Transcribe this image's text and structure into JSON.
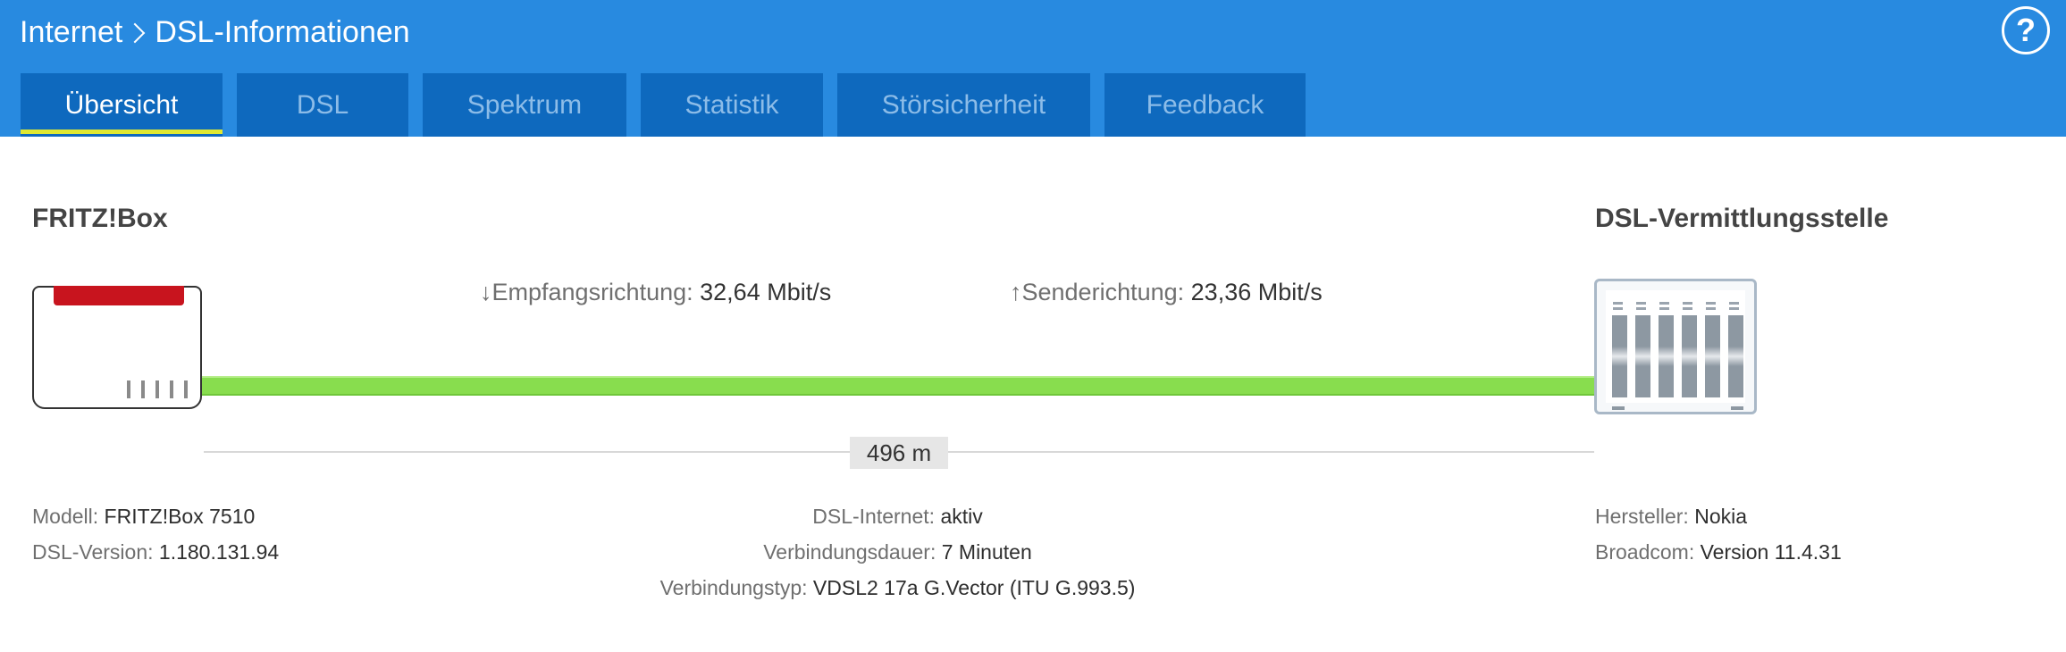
{
  "header": {
    "breadcrumb_parent": "Internet",
    "breadcrumb_current": "DSL-Informationen",
    "help_label": "?"
  },
  "tabs": [
    {
      "label": "Übersicht",
      "active": true
    },
    {
      "label": "DSL",
      "active": false
    },
    {
      "label": "Spektrum",
      "active": false
    },
    {
      "label": "Statistik",
      "active": false
    },
    {
      "label": "Störsicherheit",
      "active": false
    },
    {
      "label": "Feedback",
      "active": false
    }
  ],
  "diagram": {
    "left_title": "FRITZ!Box",
    "right_title": "DSL-Vermittlungsstelle",
    "downstream": {
      "arrow": "↓",
      "label": "Empfangsrichtung:",
      "value": "32,64 Mbit/s"
    },
    "upstream": {
      "arrow": "↑",
      "label": "Senderichtung:",
      "value": "23,36 Mbit/s"
    },
    "distance": "496 m",
    "line_status": "aktiv"
  },
  "info": {
    "left": [
      {
        "label": "Modell:",
        "value": "FRITZ!Box 7510"
      },
      {
        "label": "DSL-Version:",
        "value": "1.180.131.94"
      }
    ],
    "center": [
      {
        "label": "DSL-Internet:",
        "value": "aktiv"
      },
      {
        "label": "Verbindungsdauer:",
        "value": "7 Minuten"
      },
      {
        "label": "Verbindungstyp:",
        "value": "VDSL2 17a G.Vector (ITU G.993.5)"
      }
    ],
    "right": [
      {
        "label": "Hersteller:",
        "value": "Nokia"
      },
      {
        "label": "Broadcom:",
        "value": "Version 11.4.31"
      }
    ]
  },
  "colors": {
    "header_bg": "#288ae0",
    "tab_bg": "#0e69be",
    "active_tab_underline": "#e0e832",
    "dsl_line": "#88dd4e",
    "router_accent": "#c8141e"
  }
}
